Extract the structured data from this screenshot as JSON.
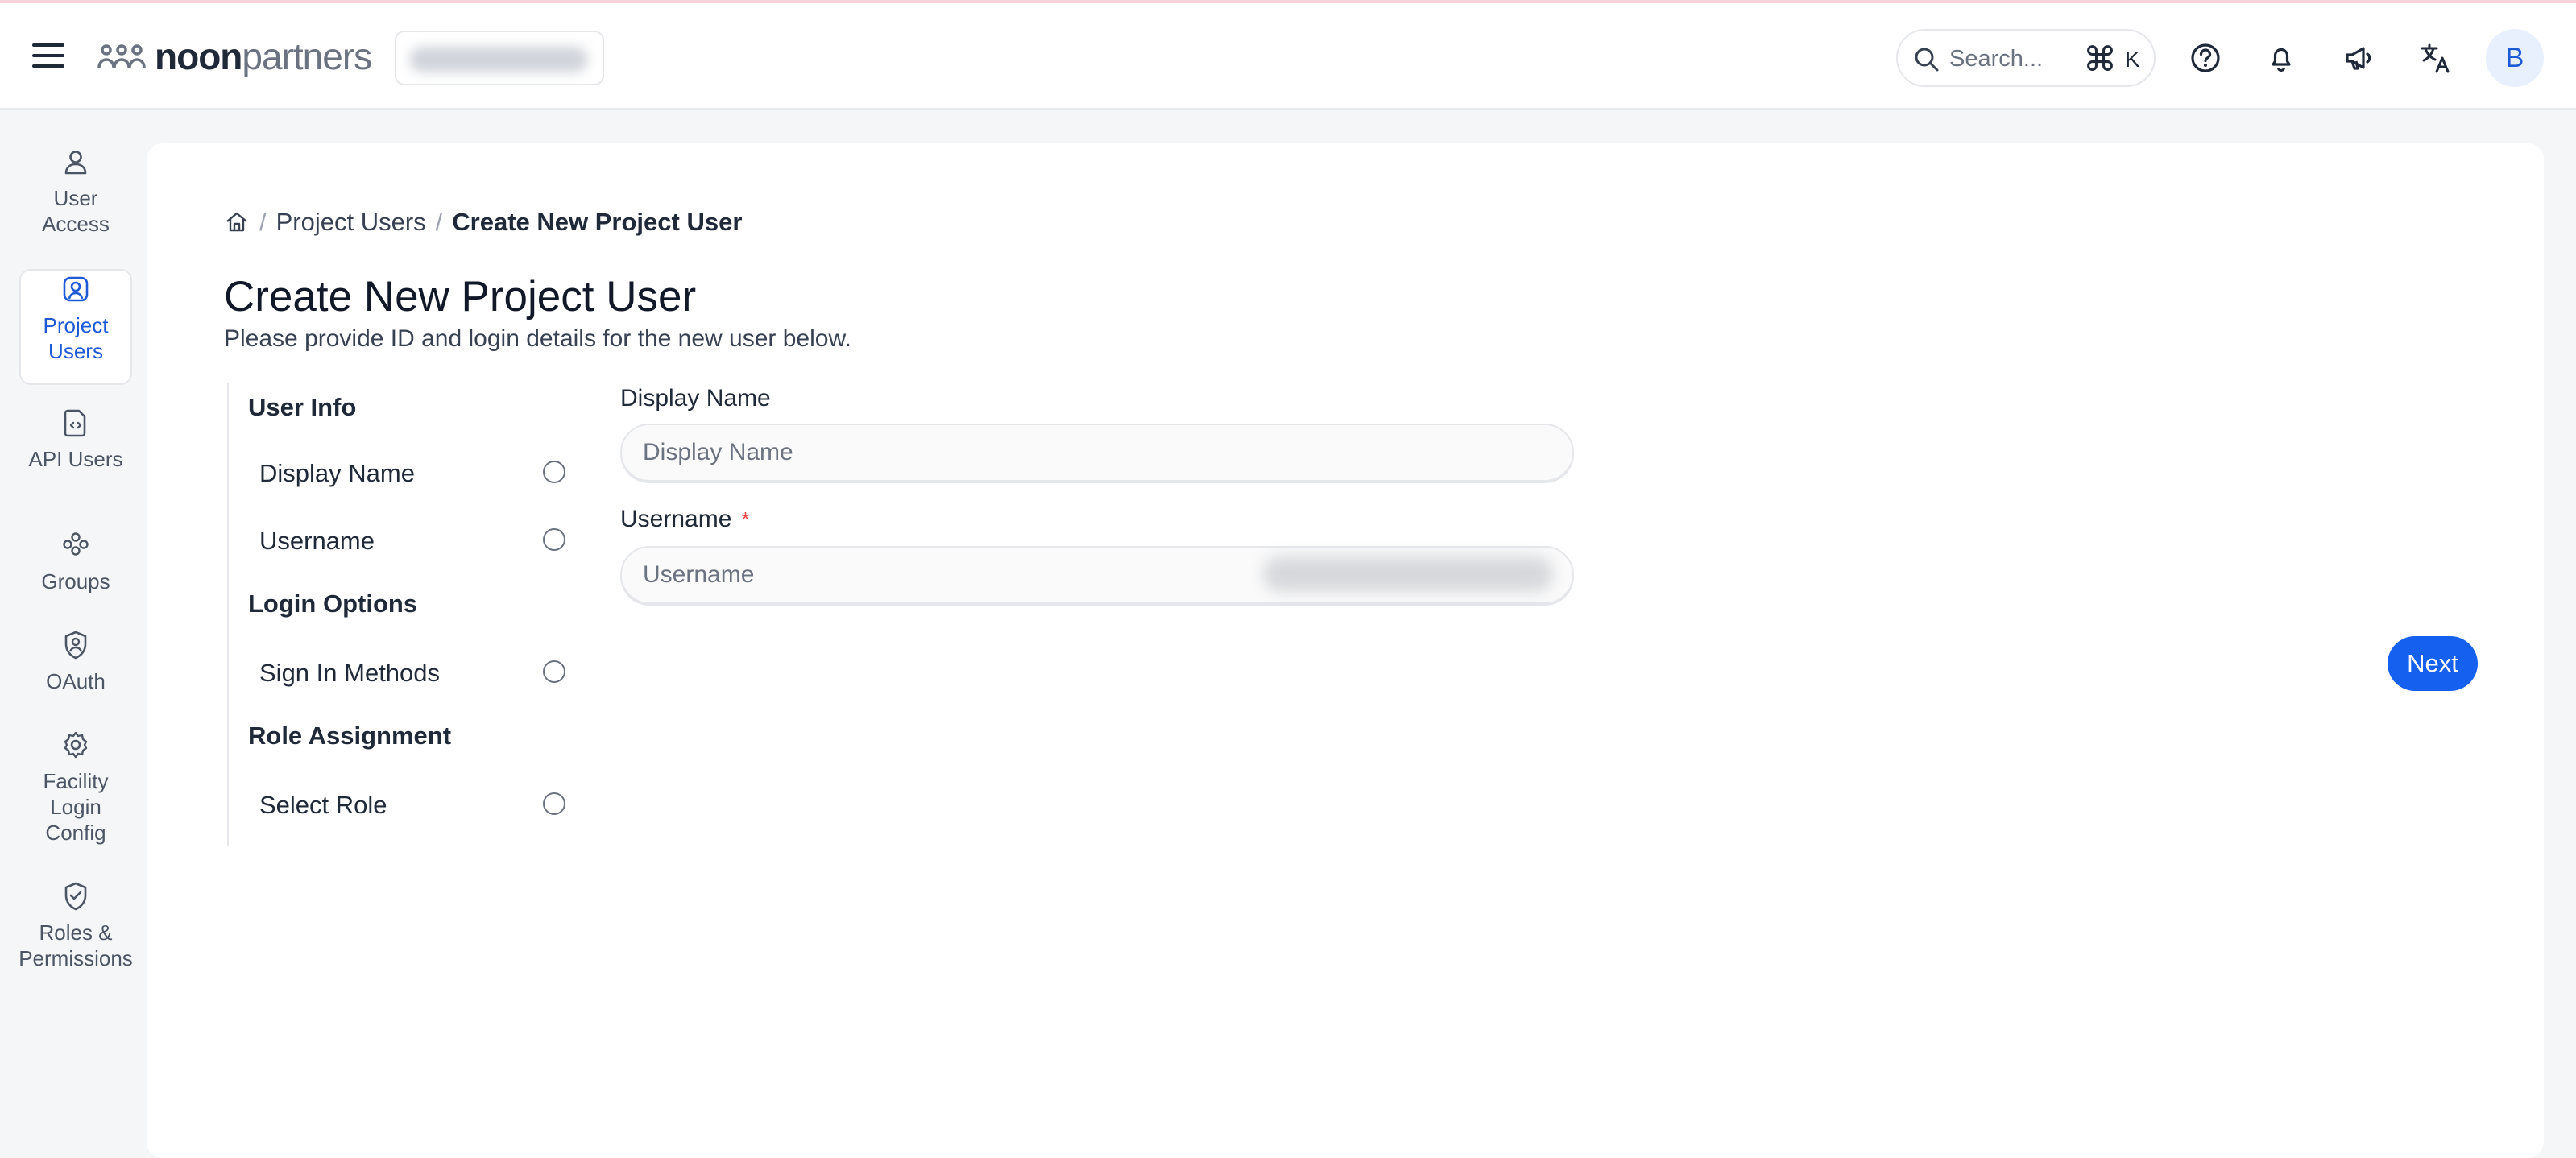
{
  "header": {
    "brand_bold": "noon",
    "brand_light": "partners",
    "search_placeholder": "Search...",
    "search_shortcut_key": "K",
    "avatar_initial": "B"
  },
  "sidebar": {
    "items": [
      {
        "label": "User Access",
        "icon": "user-icon",
        "active": false
      },
      {
        "label": "Project Users",
        "icon": "user-square-icon",
        "active": true
      },
      {
        "label": "API Users",
        "icon": "file-code-icon",
        "active": false
      },
      {
        "label": "Groups",
        "icon": "users-group-icon",
        "active": false
      },
      {
        "label": "OAuth",
        "icon": "shield-user-icon",
        "active": false
      },
      {
        "label": "Facility Login Config",
        "icon": "gear-icon",
        "active": false
      },
      {
        "label": "Roles & Permissions",
        "icon": "shield-check-icon",
        "active": false
      }
    ]
  },
  "breadcrumb": {
    "items": [
      "Project Users",
      "Create New Project User"
    ]
  },
  "page": {
    "title": "Create New Project User",
    "subtitle": "Please provide ID and login details for the new user below."
  },
  "steps": {
    "sections": [
      {
        "title": "User Info",
        "items": [
          "Display Name",
          "Username"
        ]
      },
      {
        "title": "Login Options",
        "items": [
          "Sign In Methods"
        ]
      },
      {
        "title": "Role Assignment",
        "items": [
          "Select Role"
        ]
      }
    ]
  },
  "form": {
    "display_name": {
      "label": "Display Name",
      "placeholder": "Display Name",
      "value": ""
    },
    "username": {
      "label": "Username",
      "required_mark": "*",
      "placeholder": "Username",
      "value": ""
    },
    "next_label": "Next"
  },
  "colors": {
    "accent": "#1660f0",
    "active_text": "#1f5ad6",
    "required": "#ef4444"
  }
}
